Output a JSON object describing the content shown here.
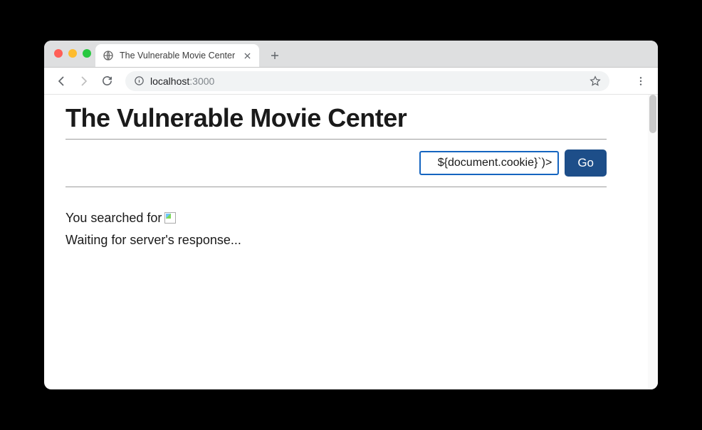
{
  "browser": {
    "tab_title": "The Vulnerable Movie Center",
    "url_host": "localhost",
    "url_path": ":3000"
  },
  "page": {
    "title": "The Vulnerable Movie Center",
    "search_value": "${document.cookie}`)>",
    "go_label": "Go",
    "searched_prefix": "You searched for ",
    "waiting_text": "Waiting for server's response..."
  }
}
